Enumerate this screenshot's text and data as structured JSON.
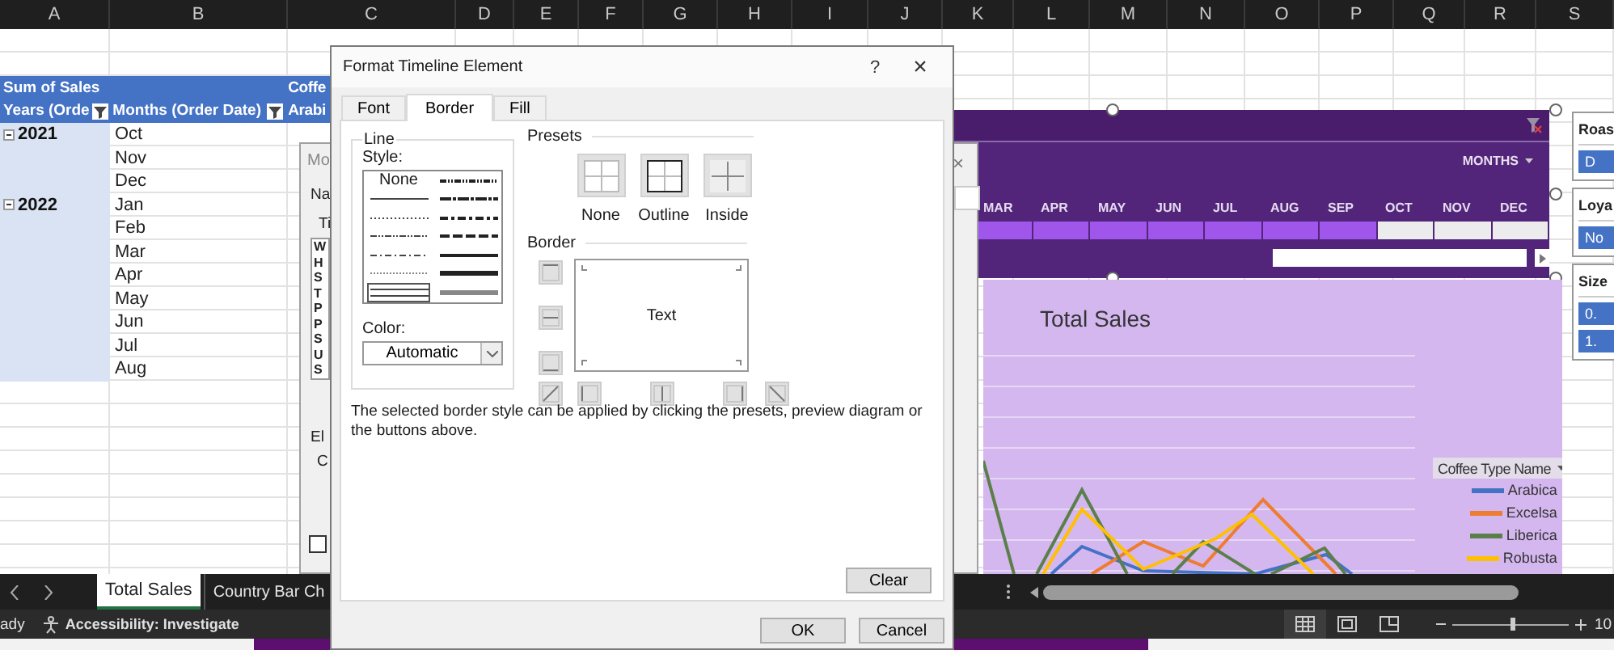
{
  "column_headers": [
    "A",
    "B",
    "C",
    "D",
    "E",
    "F",
    "G",
    "H",
    "I",
    "J",
    "K",
    "L",
    "M",
    "N",
    "O",
    "P",
    "Q",
    "R",
    "S"
  ],
  "pivot": {
    "value_field": "Sum of Sales",
    "column_field": "Coffe",
    "row_field": "Years (Orde",
    "row_field_2": "Months (Order Date)",
    "column_item": "Arabi",
    "years": [
      {
        "year": "2021",
        "expanded": true,
        "months": [
          "Oct",
          "Nov",
          "Dec"
        ]
      },
      {
        "year": "2022",
        "expanded": true,
        "months": [
          "Jan",
          "Feb",
          "Mar",
          "Apr",
          "May",
          "Jun",
          "Jul",
          "Aug"
        ]
      }
    ]
  },
  "background_dialog": {
    "title": "Mo",
    "labels": [
      "Na",
      "Ti"
    ],
    "list_items": [
      "W",
      "H",
      "S",
      "T",
      "P",
      "P",
      "S",
      "U",
      "S"
    ],
    "lower_labels": [
      "El",
      "C"
    ],
    "checkbox": {
      "checked": false
    },
    "close": "×"
  },
  "timeline": {
    "period": "MONTHS",
    "months": [
      {
        "label": "MAR",
        "selected": true
      },
      {
        "label": "APR",
        "selected": true
      },
      {
        "label": "MAY",
        "selected": true
      },
      {
        "label": "JUN",
        "selected": true
      },
      {
        "label": "JUL",
        "selected": true
      },
      {
        "label": "AUG",
        "selected": true
      },
      {
        "label": "SEP",
        "selected": true
      },
      {
        "label": "OCT",
        "selected": false
      },
      {
        "label": "NOV",
        "selected": false
      },
      {
        "label": "DEC",
        "selected": false
      }
    ]
  },
  "chart": {
    "title": "Total Sales",
    "legend_title": "Coffee Type Name",
    "series": [
      {
        "name": "Arabica",
        "color": "#4472c4"
      },
      {
        "name": "Excelsa",
        "color": "#ed7d31"
      },
      {
        "name": "Liberica",
        "color": "#5b7f4b"
      },
      {
        "name": "Robusta",
        "color": "#ffc000"
      }
    ]
  },
  "slicers": [
    {
      "title": "Roas",
      "items": [
        "D"
      ]
    },
    {
      "title": "Loya",
      "items": [
        "No"
      ]
    },
    {
      "title": "Size",
      "items": [
        "0.",
        "1."
      ]
    }
  ],
  "sheet_tabs": [
    {
      "label": "Total Sales",
      "selected": true
    },
    {
      "label": "Country Bar Ch",
      "selected": false
    }
  ],
  "status_bar": {
    "mode": "ady",
    "accessibility": "Accessibility: Investigate",
    "zoom_slider": {
      "level": 0.5
    },
    "zoom": "10"
  },
  "dialog": {
    "title": "Format Timeline Element",
    "help": "?",
    "close": "×",
    "tabs": [
      {
        "label": "Font",
        "selected": false
      },
      {
        "label": "Border",
        "selected": true
      },
      {
        "label": "Fill",
        "selected": false
      }
    ],
    "line": {
      "group": "Line",
      "style_label": "Style:",
      "styles": [
        {
          "kind": "none",
          "label": "None",
          "selected": false
        },
        {
          "kind": "thin",
          "selected": false
        },
        {
          "kind": "dotted",
          "selected": false
        },
        {
          "kind": "dash-dot-dot",
          "selected": false
        },
        {
          "kind": "dash-dot",
          "selected": false
        },
        {
          "kind": "hair",
          "selected": false
        },
        {
          "kind": "double",
          "selected": true
        },
        {
          "kind": "medium-dash-dot-dot",
          "selected": false
        },
        {
          "kind": "slant-dash-dot",
          "selected": false
        },
        {
          "kind": "medium-dash-dot",
          "selected": false
        },
        {
          "kind": "medium-dashed",
          "selected": false
        },
        {
          "kind": "medium",
          "selected": false
        },
        {
          "kind": "thick",
          "selected": false
        },
        {
          "kind": "heavy",
          "selected": false
        }
      ],
      "color_label": "Color:",
      "color_value": "Automatic"
    },
    "presets": {
      "label": "Presets",
      "items": [
        {
          "kind": "none",
          "label": "None"
        },
        {
          "kind": "outline",
          "label": "Outline"
        },
        {
          "kind": "inside",
          "label": "Inside"
        }
      ]
    },
    "border": {
      "label": "Border",
      "preview": "Text",
      "side_buttons": [
        {
          "kind": "top"
        },
        {
          "kind": "middle"
        },
        {
          "kind": "bottom"
        }
      ],
      "bottom_buttons": [
        {
          "kind": "diagonal-up"
        },
        {
          "kind": "left"
        },
        {
          "kind": "center"
        },
        {
          "kind": "right"
        },
        {
          "kind": "diagonal-down"
        }
      ]
    },
    "hint": "The selected border style can be applied by clicking the presets, preview diagram or the buttons above.",
    "buttons": {
      "clear": "Clear",
      "ok": "OK",
      "cancel": "Cancel"
    }
  }
}
